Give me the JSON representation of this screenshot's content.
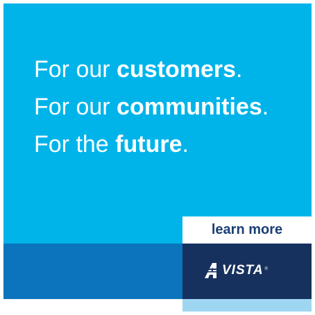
{
  "headline": {
    "lines": [
      {
        "prefix": "For our ",
        "bold": "customers",
        "suffix": "."
      },
      {
        "prefix": "For our ",
        "bold": "communities",
        "suffix": "."
      },
      {
        "prefix": "For the ",
        "bold": "future",
        "suffix": "."
      }
    ]
  },
  "cta": {
    "label": "learn more"
  },
  "logo": {
    "mark_letter": "A",
    "text": "VISTA",
    "registered": "®"
  },
  "colors": {
    "hero_bg": "#00b4ea",
    "mid_band": "#0b74bc",
    "brand_box": "#17315e",
    "bottom_right": "#9ed6f2",
    "cta_text": "#1b3f73"
  }
}
